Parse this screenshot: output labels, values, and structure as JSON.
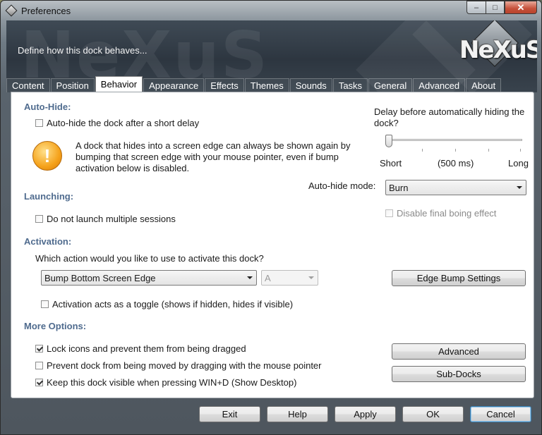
{
  "window": {
    "title": "Preferences",
    "controls": {
      "minimize": "–",
      "maximize": "□",
      "close": "✕"
    }
  },
  "header": {
    "description": "Define how this dock behaves...",
    "logo_text": "NeXuS",
    "watermark": "NeXuS"
  },
  "tabs": [
    {
      "label": "Content"
    },
    {
      "label": "Position"
    },
    {
      "label": "Behavior",
      "active": true
    },
    {
      "label": "Appearance"
    },
    {
      "label": "Effects"
    },
    {
      "label": "Themes"
    },
    {
      "label": "Sounds"
    },
    {
      "label": "Tasks"
    },
    {
      "label": "General"
    },
    {
      "label": "Advanced"
    },
    {
      "label": "About"
    }
  ],
  "autohide": {
    "heading": "Auto-Hide:",
    "checkbox_label": "Auto-hide the dock after a short delay",
    "checked": false,
    "info_text": "A dock that hides into a screen edge can always be shown again by bumping that screen edge with your mouse pointer, even if bump activation below is disabled.",
    "delay_label": "Delay before automatically hiding the dock?",
    "delay_value": 0,
    "slider_short": "Short",
    "slider_mid": "(500 ms)",
    "slider_long": "Long",
    "mode_label": "Auto-hide mode:",
    "mode_value": "Burn",
    "disable_boing_label": "Disable final boing effect",
    "disable_boing_checked": false
  },
  "launching": {
    "heading": "Launching:",
    "no_multiple_label": "Do not launch multiple sessions",
    "checked": false
  },
  "activation": {
    "heading": "Activation:",
    "question": "Which action would you like to use to activate this dock?",
    "action_value": "Bump Bottom Screen Edge",
    "key_value": "A",
    "edge_bump_button": "Edge Bump Settings",
    "toggle_label": "Activation acts as a toggle (shows if hidden, hides if visible)",
    "toggle_checked": false
  },
  "more": {
    "heading": "More Options:",
    "lock_icons_label": "Lock icons and prevent them from being dragged",
    "lock_icons_checked": true,
    "prevent_move_label": "Prevent dock from being moved by dragging with the mouse pointer",
    "prevent_move_checked": false,
    "keep_visible_label": "Keep this dock visible when pressing WIN+D (Show Desktop)",
    "keep_visible_checked": true,
    "advanced_button": "Advanced",
    "subdocks_button": "Sub-Docks"
  },
  "footer": {
    "exit": "Exit",
    "help": "Help",
    "apply": "Apply",
    "ok": "OK",
    "cancel": "Cancel"
  }
}
